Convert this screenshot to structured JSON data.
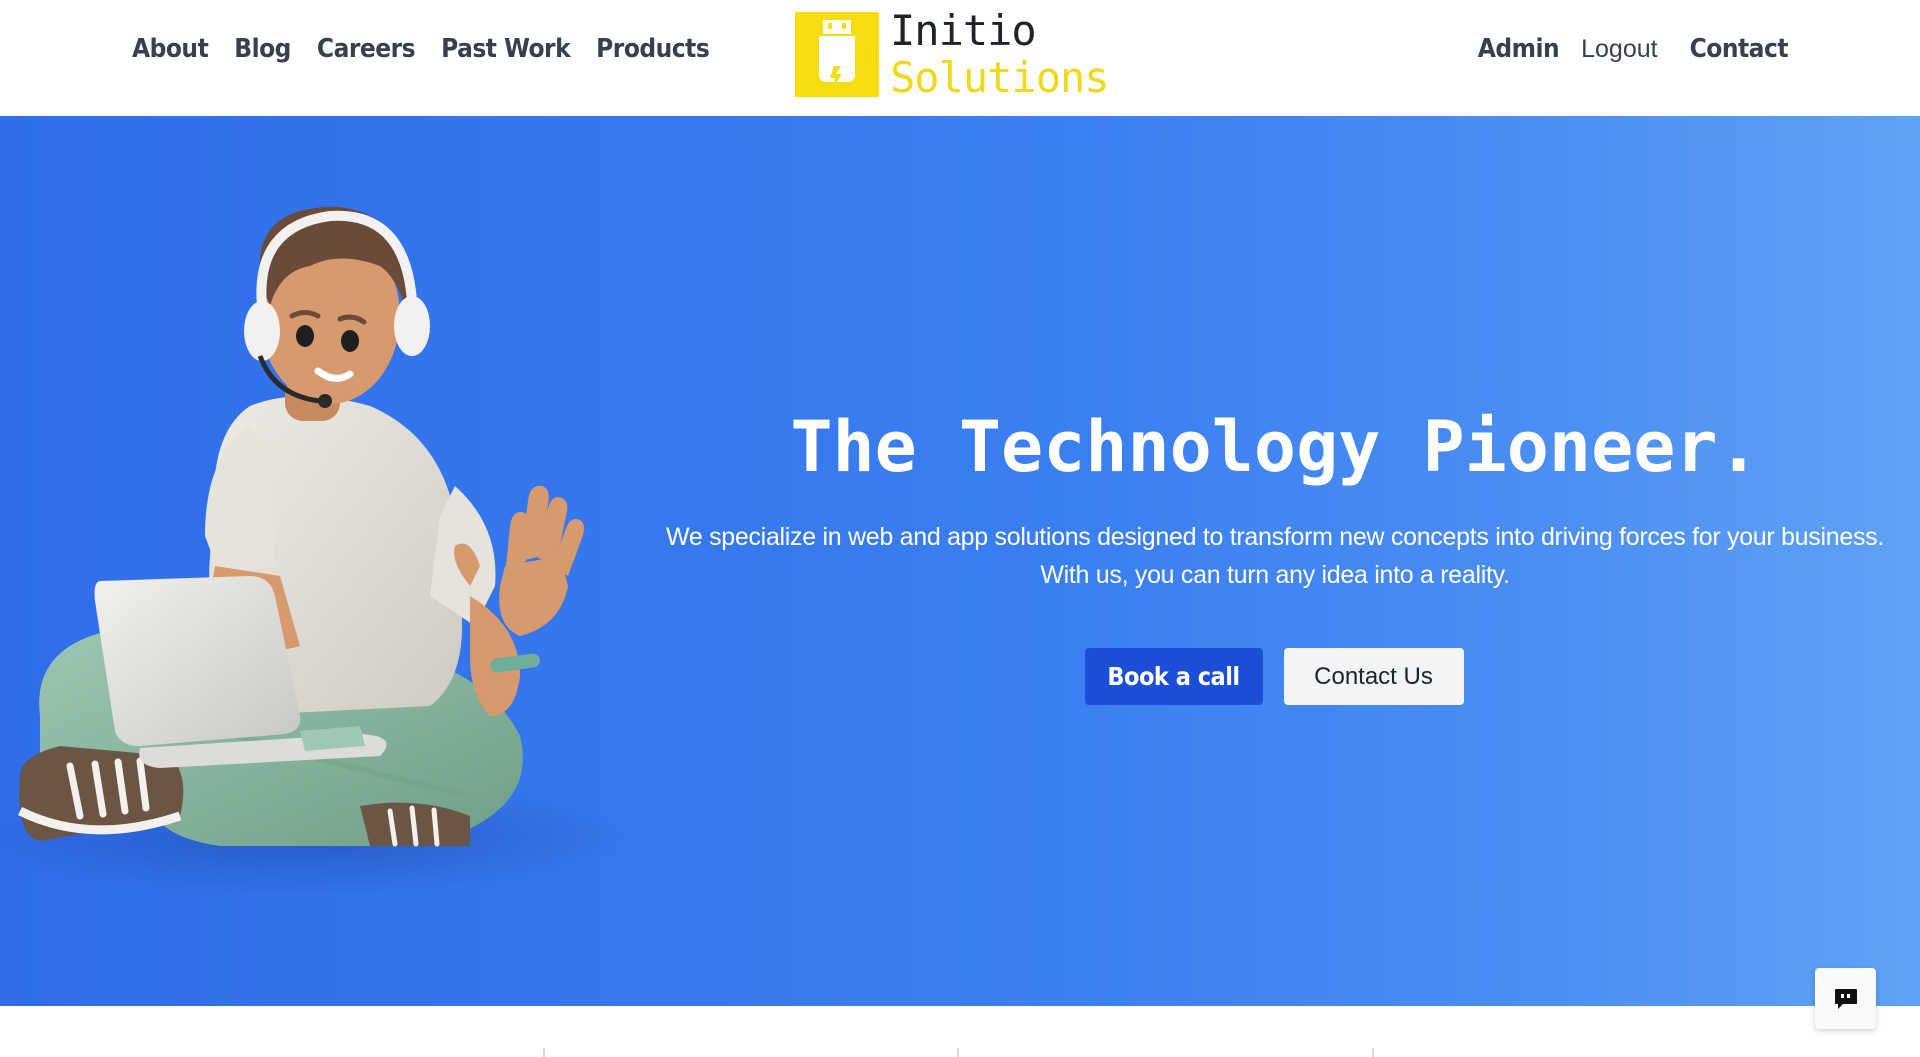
{
  "nav": {
    "left_links": [
      "About",
      "Blog",
      "Careers",
      "Past Work",
      "Products"
    ],
    "admin_label": "Admin",
    "logout_label": "Logout",
    "contact_label": "Contact"
  },
  "logo": {
    "line1": "Initio",
    "line2": "Solutions",
    "icon": "usb-plug-lightning-icon",
    "accent_color": "#f5dd12"
  },
  "hero": {
    "title": "The Technology Pioneer.",
    "description": "We specialize in web and app solutions designed to transform new concepts into driving forces for your business. With us, you can turn any idea into a reality.",
    "primary_button": "Book a call",
    "secondary_button": "Contact Us",
    "illustration": "person-with-headset-and-laptop-waving",
    "gradient_start": "#2f6de9",
    "gradient_end": "#60a2f6"
  },
  "chat_widget": {
    "icon": "chat-bubble-icon"
  },
  "colors": {
    "primary_button": "#1d4ed8",
    "nav_text": "#3a3f4b"
  }
}
